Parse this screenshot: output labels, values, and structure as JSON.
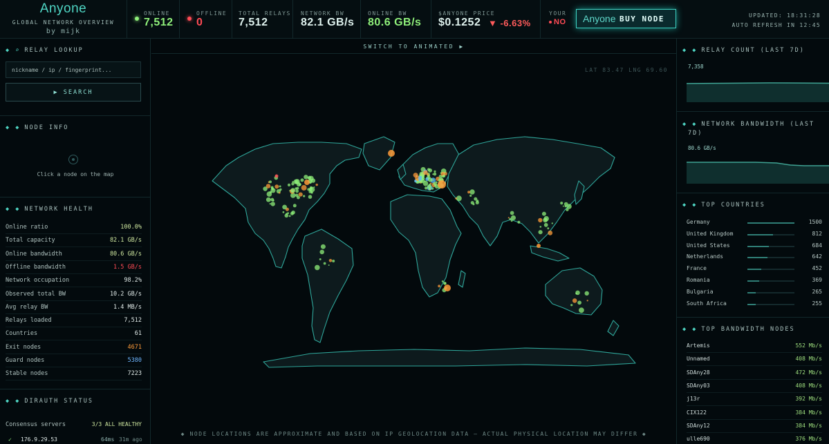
{
  "header": {
    "logo": "Anyone",
    "subtitle": "GLOBAL NETWORK OVERVIEW",
    "byline": "by mijk",
    "stats": {
      "online": {
        "label": "ONLINE",
        "value": "7,512"
      },
      "offline": {
        "label": "OFFLINE",
        "value": "0"
      },
      "total_relays": {
        "label": "TOTAL RELAYS",
        "value": "7,512"
      },
      "network_bw": {
        "label": "NETWORK BW",
        "value": "82.1 GB/s"
      },
      "online_bw": {
        "label": "ONLINE BW",
        "value": "80.6 GB/s"
      },
      "price": {
        "label": "$ANYONE PRICE",
        "value": "$0.1252",
        "change": "▼ -6.63%"
      },
      "yours": {
        "label": "YOUR",
        "value": "NO"
      }
    },
    "buy_button": {
      "logo": "Anyone",
      "label": "BUY NODE"
    },
    "updated": "UPDATED: 18:31:28",
    "auto_refresh": "AUTO REFRESH IN 12:45"
  },
  "colors": {
    "accent": "#4fd6c4",
    "online": "#8ff07a",
    "offline": "#ff4b55",
    "orange": "#ff9c3a",
    "blue": "#5ab8ff",
    "exit": "#ff9c3a",
    "guard": "#6fb7ff"
  },
  "relay_lookup": {
    "title": "RELAY LOOKUP",
    "placeholder": "nickname / ip / fingerprint...",
    "search_label": "▶ SEARCH"
  },
  "node_info": {
    "title": "NODE INFO",
    "empty_text": "Click a node on the map"
  },
  "network_health": {
    "title": "NETWORK HEALTH",
    "rows": [
      {
        "label": "Online ratio",
        "value": "100.0%"
      },
      {
        "label": "Total capacity",
        "value": "82.1 GB/s"
      },
      {
        "label": "Online bandwidth",
        "value": "80.6 GB/s"
      },
      {
        "label": "Offline bandwidth",
        "value": "1.5 GB/s"
      },
      {
        "label": "Network occupation",
        "value": "98.2%"
      },
      {
        "label": "Observed total BW",
        "value": "10.2 GB/s"
      },
      {
        "label": "Avg relay BW",
        "value": "1.4 MB/s"
      },
      {
        "label": "Relays loaded",
        "value": "7,512"
      },
      {
        "label": "Countries",
        "value": "61"
      },
      {
        "label": "Exit nodes",
        "value": "4671"
      },
      {
        "label": "Guard nodes",
        "value": "5380"
      },
      {
        "label": "Stable nodes",
        "value": "7223"
      }
    ]
  },
  "dirauth": {
    "title": "DIRAUTH STATUS",
    "consensus_label": "Consensus servers",
    "consensus_value": "3/3 ALL HEALTHY",
    "server": {
      "check": "✓",
      "ip": "176.9.29.53",
      "latency": "64ms",
      "age": "31m ago"
    }
  },
  "map": {
    "switch_label": "SWITCH TO ANIMATED ▶",
    "latlng": "LAT 83.47  LNG 69.60",
    "footnote": "◆ NODE LOCATIONS ARE APPROXIMATE AND BASED ON IP GEOLOCATION DATA — ACTUAL PHYSICAL LOCATION MAY DIFFER ◆"
  },
  "relay_count": {
    "title": "RELAY COUNT (LAST 7D)",
    "value": "7,358"
  },
  "bandwidth": {
    "title_1": "NETWORK BANDWIDTH (LAST",
    "title_2": "7D)",
    "value": "80.6 GB/s"
  },
  "top_countries": {
    "title": "TOP COUNTRIES",
    "items": [
      {
        "name": "Germany",
        "count": "1500",
        "share": 1.0
      },
      {
        "name": "United Kingdom",
        "count": "812",
        "share": 0.54
      },
      {
        "name": "United States",
        "count": "684",
        "share": 0.46
      },
      {
        "name": "Netherlands",
        "count": "642",
        "share": 0.43
      },
      {
        "name": "France",
        "count": "452",
        "share": 0.3
      },
      {
        "name": "Romania",
        "count": "369",
        "share": 0.25
      },
      {
        "name": "Bulgaria",
        "count": "265",
        "share": 0.18
      },
      {
        "name": "South Africa",
        "count": "255",
        "share": 0.17
      }
    ]
  },
  "top_bandwidth": {
    "title": "TOP BANDWIDTH NODES",
    "items": [
      {
        "name": "Artemis",
        "bw": "552 Mb/s"
      },
      {
        "name": "Unnamed",
        "bw": "408 Mb/s"
      },
      {
        "name": "SDAny28",
        "bw": "472 Mb/s"
      },
      {
        "name": "SDAny03",
        "bw": "408 Mb/s"
      },
      {
        "name": "j13r",
        "bw": "392 Mb/s"
      },
      {
        "name": "CIX122",
        "bw": "384 Mb/s"
      },
      {
        "name": "SDAny12",
        "bw": "384 Mb/s"
      },
      {
        "name": "ulle690",
        "bw": "376 Mb/s"
      }
    ]
  }
}
